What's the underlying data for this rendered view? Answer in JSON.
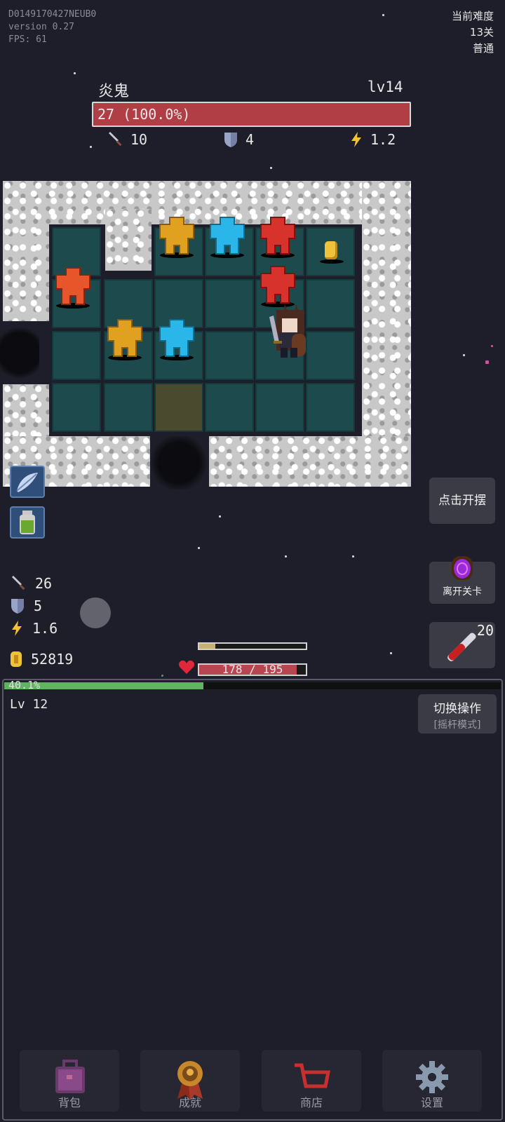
{
  "debug": {
    "device_id": "D0149170427NEUB0",
    "version": "version 0.27",
    "fps": "FPS: 61"
  },
  "difficulty": {
    "label": "当前难度",
    "stage": "13关",
    "mode": "普通"
  },
  "enemy": {
    "name": "炎鬼",
    "level": "lv14",
    "hp_text": "27 (100.0%)",
    "hp_fraction": 1.0,
    "attack": "10",
    "defense": "4",
    "speed": "1.2"
  },
  "player": {
    "attack": "26",
    "defense": "5",
    "speed": "1.6",
    "gold": "52819",
    "hp_text": "178 / 195",
    "hp_fraction": 0.913,
    "exp_fraction": 0.15,
    "level_progress_text": "40.1%",
    "level_progress_fraction": 0.401,
    "level": "Lv 12"
  },
  "buttons": {
    "idle": "点击开摆",
    "leave": "离开关卡",
    "potion_count": "20",
    "switch_title": "切换操作",
    "switch_mode": "[摇杆模式]"
  },
  "nav": {
    "bag": "背包",
    "achievements": "成就",
    "shop": "商店",
    "settings": "设置"
  },
  "icons": {
    "sword": "sword-icon",
    "shield": "shield-icon",
    "lightning": "lightning-icon",
    "coin": "coin-icon",
    "heart": "heart-icon",
    "portal": "portal-icon",
    "potion": "potion-icon",
    "gear": "gear-icon",
    "medal": "medal-icon",
    "cart": "cart-icon",
    "backpack": "backpack-icon"
  },
  "colors": {
    "enemy_hp": "#b23e45",
    "player_hp": "#b84650",
    "exp": "#c9b07a",
    "level": "#5fb45f",
    "red_monster": "#d8322c",
    "orange_monster": "#e8552a",
    "yellow_monster": "#e0a020",
    "blue_monster": "#2ab6e8"
  }
}
